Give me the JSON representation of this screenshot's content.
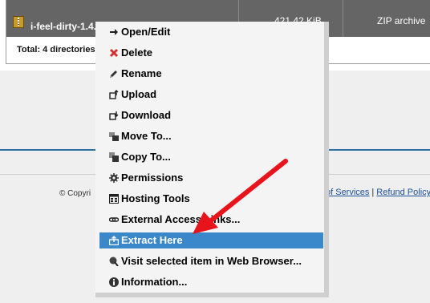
{
  "file_row": {
    "name": "i-feel-dirty-1.4.",
    "size": "421.42 KiB",
    "type": "ZIP archive"
  },
  "total_text": "Total: 4 directories",
  "footer": {
    "copyright": "© Copyri",
    "terms": "of Services",
    "separator": "|",
    "refund": "Refund Policy"
  },
  "context_menu": {
    "items": [
      {
        "label": "Open/Edit",
        "icon": "arrow-right-icon"
      },
      {
        "label": "Delete",
        "icon": "delete-x-icon",
        "color": "#d32f2f"
      },
      {
        "label": "Rename",
        "icon": "pencil-icon"
      },
      {
        "label": "Upload",
        "icon": "upload-icon"
      },
      {
        "label": "Download",
        "icon": "download-icon"
      },
      {
        "label": "Move To...",
        "icon": "move-icon"
      },
      {
        "label": "Copy To...",
        "icon": "copy-icon"
      },
      {
        "label": "Permissions",
        "icon": "gear-icon"
      },
      {
        "label": "Hosting Tools",
        "icon": "tools-icon"
      },
      {
        "label": "External Access Links...",
        "icon": "link-icon"
      },
      {
        "label": "Extract Here",
        "icon": "extract-icon",
        "selected": true
      },
      {
        "label": "Visit selected item in Web Browser...",
        "icon": "globe-icon"
      },
      {
        "label": "Information...",
        "icon": "info-icon"
      }
    ]
  },
  "annotation": {
    "color": "#e8141c",
    "icon": "red-arrow"
  }
}
